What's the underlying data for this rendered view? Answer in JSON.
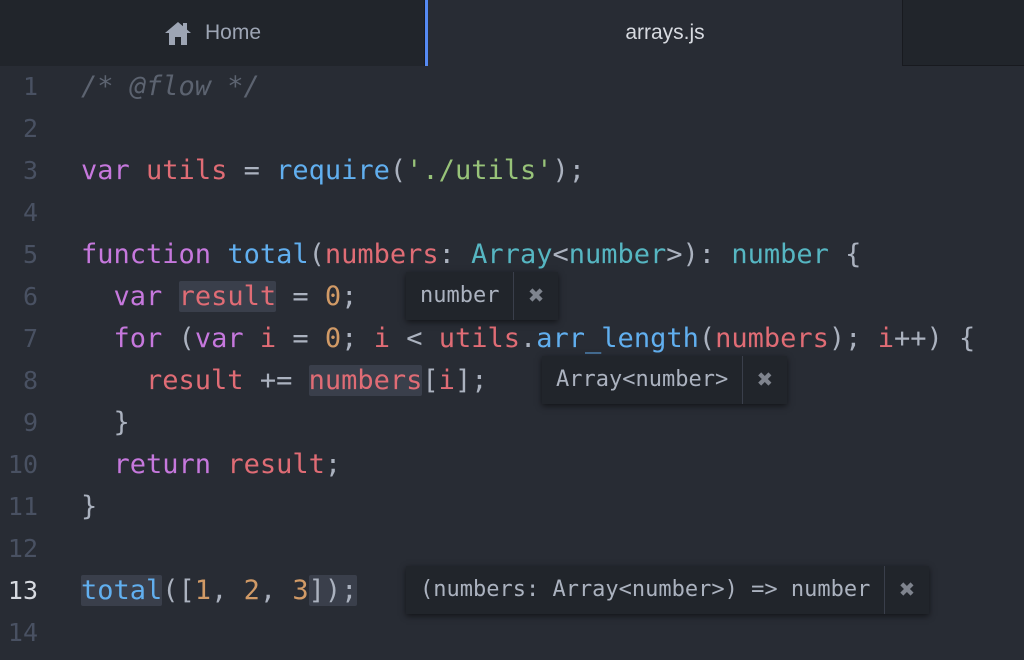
{
  "tabs": {
    "home": {
      "label": "Home",
      "icon": "home-icon"
    },
    "active": {
      "label": "arrays.js"
    }
  },
  "lines": {
    "n1": "1",
    "n2": "2",
    "n3": "3",
    "n4": "4",
    "n5": "5",
    "n6": "6",
    "n7": "7",
    "n8": "8",
    "n9": "9",
    "n10": "10",
    "n11": "11",
    "n12": "12",
    "n13": "13",
    "n14": "14"
  },
  "code": {
    "l1": {
      "comment": "/* @flow */"
    },
    "l3": {
      "kw": "var",
      "name": "utils",
      "eq": " = ",
      "fn": "require",
      "open": "(",
      "str": "'./utils'",
      "close": ");"
    },
    "l5": {
      "kw": "function",
      "fn": "total",
      "open": "(",
      "param": "numbers",
      "colon": ": ",
      "type1": "Array",
      "lt": "<",
      "type2": "number",
      "gt": ">",
      "close": "): ",
      "ret": "number",
      "brace": " {"
    },
    "l6": {
      "kw": "var",
      "name": "result",
      "eq": " = ",
      "num": "0",
      "semi": ";"
    },
    "l7": {
      "kw": "for",
      "open": " (",
      "kw2": "var",
      "i1": "i",
      "eq": " = ",
      "num": "0",
      "semi1": "; ",
      "i2": "i",
      "lt": " < ",
      "obj": "utils",
      "dot": ".",
      "fn": "arr_length",
      "p1": "(",
      "arg": "numbers",
      "p2": "); ",
      "i3": "i",
      "inc": "++) {"
    },
    "l8": {
      "name": "result",
      "op": " += ",
      "arr": "numbers",
      "b1": "[",
      "idx": "i",
      "b2": "];"
    },
    "l9": {
      "brace": "}"
    },
    "l10": {
      "kw": "return",
      "name": "result",
      "semi": ";"
    },
    "l11": {
      "brace": "}"
    },
    "l13": {
      "fn": "total",
      "open": "([",
      "n1": "1",
      "c1": ", ",
      "n2": "2",
      "c2": ", ",
      "n3": "3",
      "close": "]);"
    }
  },
  "tooltips": {
    "t1": {
      "text": "number"
    },
    "t2": {
      "text": "Array<number>"
    },
    "t3": {
      "text": "(numbers: Array<number>) => number"
    }
  },
  "colors": {
    "accent": "#568af2",
    "background": "#282c34",
    "keyword": "#c678dd",
    "variable": "#e06c75",
    "function": "#61afef",
    "string": "#98c379",
    "number": "#d19a66",
    "type": "#56b6c2"
  }
}
